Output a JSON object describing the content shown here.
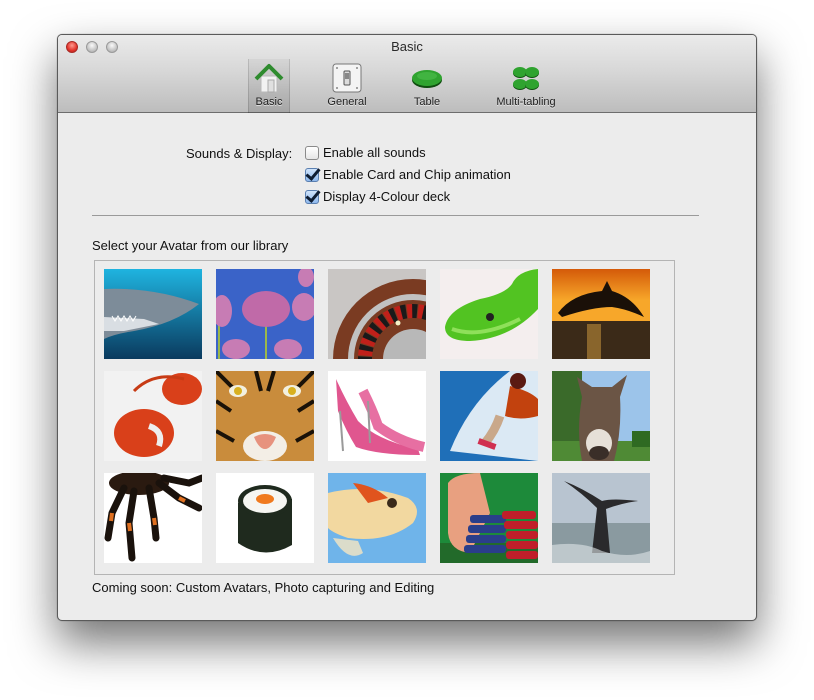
{
  "window": {
    "title": "Basic",
    "controls": [
      "close",
      "minimize",
      "zoom"
    ]
  },
  "toolbar": {
    "tabs": [
      {
        "label": "Basic",
        "icon": "house-icon",
        "selected": true
      },
      {
        "label": "General",
        "icon": "toggle-switch-icon",
        "selected": false
      },
      {
        "label": "Table",
        "icon": "poker-table-icon",
        "selected": false
      },
      {
        "label": "Multi-tabling",
        "icon": "multi-table-icon",
        "selected": false
      }
    ]
  },
  "sounds_display": {
    "label": "Sounds & Display:",
    "options": [
      {
        "label": "Enable all sounds",
        "checked": false
      },
      {
        "label": "Enable Card and Chip animation",
        "checked": true
      },
      {
        "label": "Display 4-Colour deck",
        "checked": true
      }
    ]
  },
  "avatars": {
    "heading": "Select your Avatar from our library",
    "items": [
      {
        "name": "shark"
      },
      {
        "name": "tulips"
      },
      {
        "name": "roulette"
      },
      {
        "name": "green-snake"
      },
      {
        "name": "dolphin-sunset"
      },
      {
        "name": "lobster"
      },
      {
        "name": "tiger"
      },
      {
        "name": "pink-heels"
      },
      {
        "name": "snowboarder"
      },
      {
        "name": "donkey"
      },
      {
        "name": "tarantula"
      },
      {
        "name": "sushi"
      },
      {
        "name": "goldfish"
      },
      {
        "name": "poker-chips"
      },
      {
        "name": "whale-tail"
      }
    ]
  },
  "footer_note": "Coming soon: Custom Avatars, Photo capturing and Editing",
  "colors": {
    "accent_green": "#2e8b2e",
    "checkbox_blue": "#8fb9ee",
    "close_red": "#e2342b"
  }
}
